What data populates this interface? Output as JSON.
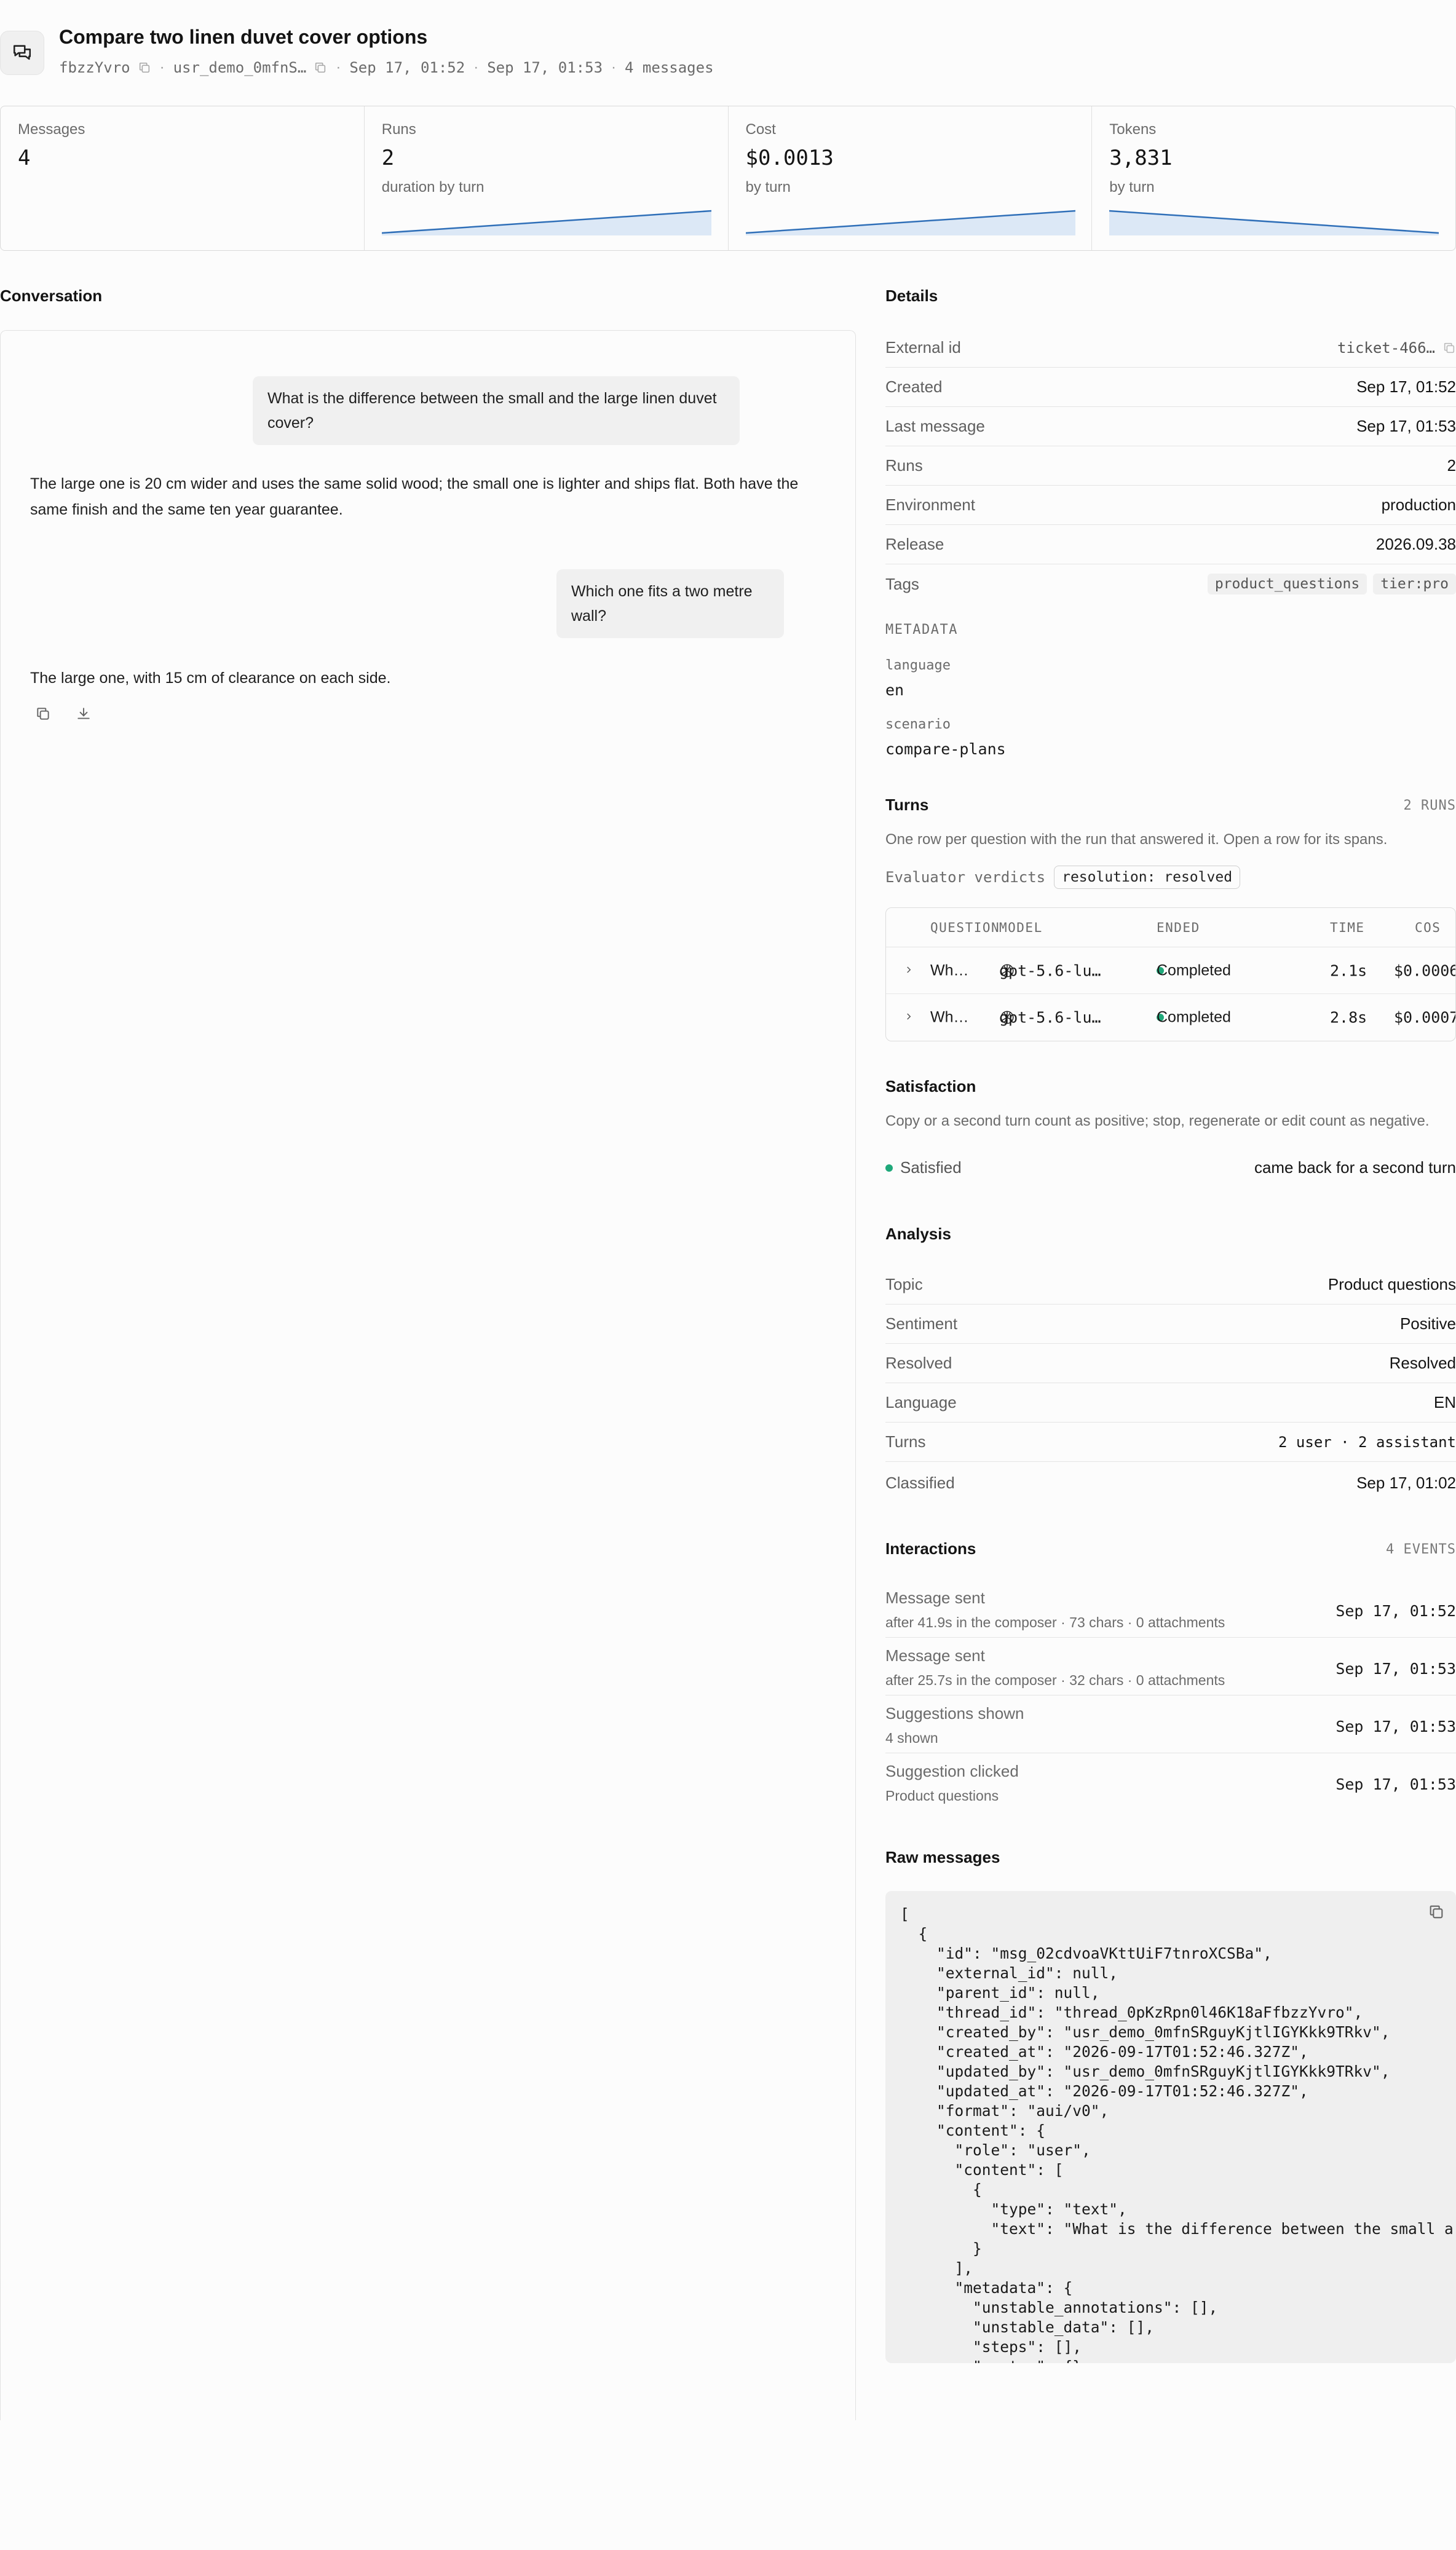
{
  "header": {
    "title": "Compare two linen duvet cover options",
    "thread_short_id": "fbzzYvro",
    "user": "usr_demo_0mfnS…",
    "created": "Sep 17, 01:52",
    "last": "Sep 17, 01:53",
    "messages_count": "4 messages"
  },
  "stats": [
    {
      "label": "Messages",
      "value": "4",
      "sub": ""
    },
    {
      "label": "Runs",
      "value": "2",
      "sub": "duration by turn",
      "trend": [
        2.1,
        2.8
      ]
    },
    {
      "label": "Cost",
      "value": "$0.0013",
      "sub": "by turn",
      "trend": [
        0.0006,
        0.0007
      ]
    },
    {
      "label": "Tokens",
      "value": "3,831",
      "sub": "by turn",
      "trend": [
        1,
        0.4
      ]
    }
  ],
  "conversation": {
    "title": "Conversation",
    "messages": [
      {
        "role": "user",
        "text": "What is the difference between the small and the large linen duvet cover?"
      },
      {
        "role": "assistant",
        "text": "The large one is 20 cm wider and uses the same solid wood; the small one is lighter and ships flat. Both have the same finish and the same ten year guarantee."
      },
      {
        "role": "user",
        "text": "Which one fits a two metre wall?"
      },
      {
        "role": "assistant",
        "text": "The large one, with 15 cm of clearance on each side."
      }
    ]
  },
  "details": {
    "title": "Details",
    "rows": [
      {
        "key": "External id",
        "value": "ticket-466…"
      },
      {
        "key": "Created",
        "value": "Sep 17, 01:52"
      },
      {
        "key": "Last message",
        "value": "Sep 17, 01:53"
      },
      {
        "key": "Runs",
        "value": "2"
      },
      {
        "key": "Environment",
        "value": "production"
      },
      {
        "key": "Release",
        "value": "2026.09.38"
      }
    ],
    "tags_label": "Tags",
    "tags": [
      "product_questions",
      "tier:pro"
    ],
    "metadata_label": "METADATA",
    "metadata": [
      {
        "key": "language",
        "value": "en"
      },
      {
        "key": "scenario",
        "value": "compare-plans"
      }
    ]
  },
  "turns": {
    "title": "Turns",
    "count": "2 RUNS",
    "description": "One row per question with the run that answered it. Open a row for its spans.",
    "verdicts_label": "Evaluator verdicts",
    "verdict": "resolution: resolved",
    "columns": [
      "QUESTION",
      "MODEL",
      "ENDED",
      "TIME",
      "COS"
    ],
    "rows": [
      {
        "question": "Wh…",
        "model": "gpt-5.6-lu…",
        "ended": "Completed",
        "time": "2.1s",
        "cost": "$0.0006"
      },
      {
        "question": "Wh…",
        "model": "gpt-5.6-lu…",
        "ended": "Completed",
        "time": "2.8s",
        "cost": "$0.0007"
      }
    ]
  },
  "satisfaction": {
    "title": "Satisfaction",
    "description": "Copy or a second turn count as positive; stop, regenerate or edit count as negative.",
    "status": "Satisfied",
    "reason": "came back for a second turn"
  },
  "analysis": {
    "title": "Analysis",
    "rows": [
      {
        "key": "Topic",
        "value": "Product questions"
      },
      {
        "key": "Sentiment",
        "value": "Positive"
      },
      {
        "key": "Resolved",
        "value": "Resolved"
      },
      {
        "key": "Language",
        "value": "EN"
      },
      {
        "key": "Turns",
        "value": "2 user · 2 assistant"
      },
      {
        "key": "Classified",
        "value": "Sep 17, 01:02"
      }
    ]
  },
  "interactions": {
    "title": "Interactions",
    "count": "4 EVENTS",
    "rows": [
      {
        "title": "Message sent",
        "sub": "after 41.9s in the composer · 73 chars · 0 attachments",
        "time": "Sep 17, 01:52"
      },
      {
        "title": "Message sent",
        "sub": "after 25.7s in the composer · 32 chars · 0 attachments",
        "time": "Sep 17, 01:53"
      },
      {
        "title": "Suggestions shown",
        "sub": "4 shown",
        "time": "Sep 17, 01:53"
      },
      {
        "title": "Suggestion clicked",
        "sub": "Product questions",
        "time": "Sep 17, 01:53"
      }
    ]
  },
  "raw": {
    "title": "Raw messages",
    "json": "[\n  {\n    \"id\": \"msg_02cdvoaVKttUiF7tnroXCSBa\",\n    \"external_id\": null,\n    \"parent_id\": null,\n    \"thread_id\": \"thread_0pKzRpn0l46K18aFfbzzYvro\",\n    \"created_by\": \"usr_demo_0mfnSRguyKjtlIGYKkk9TRkv\",\n    \"created_at\": \"2026-09-17T01:52:46.327Z\",\n    \"updated_by\": \"usr_demo_0mfnSRguyKjtlIGYKkk9TRkv\",\n    \"updated_at\": \"2026-09-17T01:52:46.327Z\",\n    \"format\": \"aui/v0\",\n    \"content\": {\n      \"role\": \"user\",\n      \"content\": [\n        {\n          \"type\": \"text\",\n          \"text\": \"What is the difference between the small a\n        }\n      ],\n      \"metadata\": {\n        \"unstable_annotations\": [],\n        \"unstable_data\": [],\n        \"steps\": [],\n        \"custom\": {}"
  }
}
